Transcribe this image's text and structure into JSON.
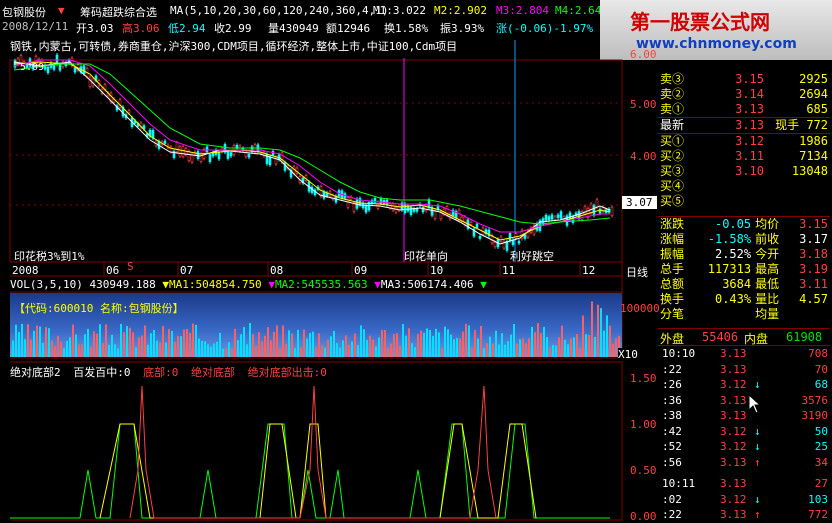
{
  "title_bar": {
    "stock_name": "包钢股份",
    "indicator_name": "筹码超跌综合选",
    "ma_label": "MA(5,10,20,30,60,120,240,360,4,1)",
    "m1": "M1:3.022",
    "m2": "M2:2.902",
    "m3": "M3:2.804",
    "m4": "M4:2.649"
  },
  "info_bar": {
    "date": "2008/12/11",
    "open": "开3.03",
    "high": "高3.06",
    "low": "低2.94",
    "close": "收2.99",
    "volume": "量430949",
    "amount": "额12946",
    "turnover": "换1.58%",
    "amplitude": "振3.93%",
    "change": "涨(-0.06)-1.97%",
    "index_label": "指数"
  },
  "concept_text": "钢铁,内蒙古,可转债,券商重仓,沪深300,CDM项目,循环经济,整体上市,中证100,Cdm项目",
  "main_chart": {
    "y_ticks": [
      "6.00",
      "5.00",
      "4.00",
      "3.00"
    ],
    "x_months": [
      "2008",
      "06",
      "07",
      "08",
      "09",
      "10",
      "11",
      "12"
    ],
    "x_axis_label": "日线",
    "annotations": [
      "印花税3%到1%",
      "印花单向",
      "利好跳空"
    ],
    "start_value_label": "5.09",
    "current_price_badge": "3.07",
    "marker_s": "S"
  },
  "volume_panel": {
    "header_label": "VOL(3,5,10)",
    "vol_value": "430949.188",
    "ma1": "MA1:504854.750",
    "ma2": "MA2:545535.563",
    "ma3": "MA3:506174.406",
    "code_label": "【代码:600010 名称:包钢股份】",
    "y_tick": "100000",
    "multiplier": "X10"
  },
  "bottom_panel": {
    "title": "绝对底部2",
    "label1": "百发百中:0",
    "label2": "底部:0",
    "label3": "绝对底部",
    "label4": "绝对底部出击:0",
    "y_ticks": [
      "1.50",
      "1.00",
      "0.50",
      "0.00"
    ]
  },
  "logo": {
    "title": "第一股票公式网",
    "url": "www.chnmoney.com"
  },
  "order_book": {
    "sells": [
      {
        "label": "卖③",
        "price": "3.15",
        "volume": "2925"
      },
      {
        "label": "卖②",
        "price": "3.14",
        "volume": "2694"
      },
      {
        "label": "卖①",
        "price": "3.13",
        "volume": "685"
      }
    ],
    "latest": {
      "label": "最新",
      "price": "3.13",
      "hand_label": "现手",
      "hand": "772"
    },
    "buys": [
      {
        "label": "买①",
        "price": "3.12",
        "volume": "1986"
      },
      {
        "label": "买②",
        "price": "3.11",
        "volume": "7134"
      },
      {
        "label": "买③",
        "price": "3.10",
        "volume": "13048"
      },
      {
        "label": "买④",
        "price": "",
        "volume": ""
      },
      {
        "label": "买⑤",
        "price": "",
        "volume": ""
      }
    ]
  },
  "stats": [
    {
      "l1": "涨跌",
      "v1": "-0.05",
      "l2": "均价",
      "v2": "3.15"
    },
    {
      "l1": "涨幅",
      "v1": "-1.58%",
      "l2": "前收",
      "v2": "3.17"
    },
    {
      "l1": "振幅",
      "v1": "2.52%",
      "l2": "今开",
      "v2": "3.18"
    },
    {
      "l1": "总手",
      "v1": "117313",
      "l2": "最高",
      "v2": "3.19"
    },
    {
      "l1": "总额",
      "v1": "3684",
      "l2": "最低",
      "v2": "3.11"
    },
    {
      "l1": "换手",
      "v1": "0.43%",
      "l2": "量比",
      "v2": "4.57"
    },
    {
      "l1": "分笔",
      "v1": "",
      "l2": "均量",
      "v2": ""
    }
  ],
  "outer_inner": {
    "outer_label": "外盘",
    "outer": "55406",
    "inner_label": "内盘",
    "inner": "61908"
  },
  "ticks": [
    {
      "time": "10:10",
      "price": "3.13",
      "arrow": "",
      "vol": "708"
    },
    {
      "time": ":22",
      "price": "3.13",
      "arrow": "",
      "vol": "70"
    },
    {
      "time": ":26",
      "price": "3.12",
      "arrow": "↓",
      "vol": "68"
    },
    {
      "time": ":36",
      "price": "3.13",
      "arrow": "",
      "vol": "3576"
    },
    {
      "time": ":38",
      "price": "3.13",
      "arrow": "",
      "vol": "3190"
    },
    {
      "time": ":42",
      "price": "3.12",
      "arrow": "↓",
      "vol": "50"
    },
    {
      "time": ":52",
      "price": "3.12",
      "arrow": "↓",
      "vol": "25"
    },
    {
      "time": ":56",
      "price": "3.13",
      "arrow": "↑",
      "vol": "34"
    },
    {
      "time": "10:11",
      "price": "3.13",
      "arrow": "",
      "vol": "27"
    },
    {
      "time": ":02",
      "price": "3.12",
      "arrow": "↓",
      "vol": "103"
    },
    {
      "time": ":22",
      "price": "3.13",
      "arrow": "↑",
      "vol": "772"
    }
  ],
  "colors": {
    "up": "#ff4040",
    "down": "#00ffff",
    "label": "#ffff00",
    "grid": "#800000"
  }
}
